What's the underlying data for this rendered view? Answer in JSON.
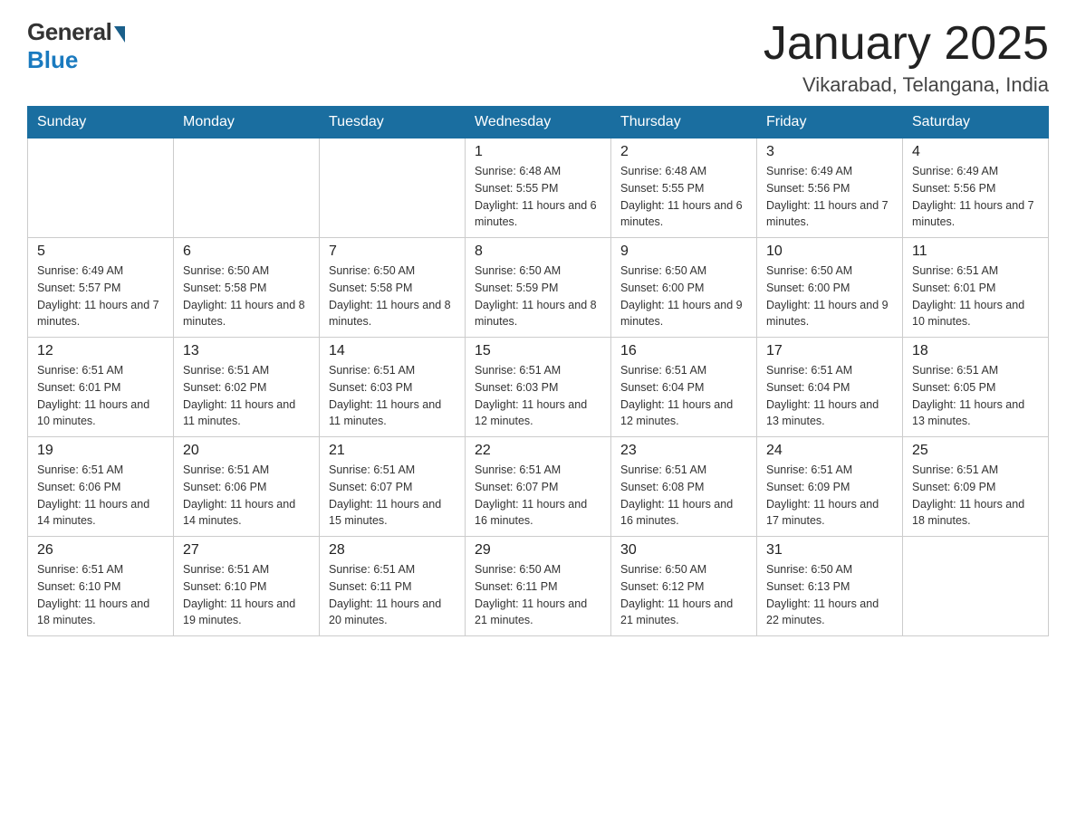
{
  "header": {
    "logo_general": "General",
    "logo_blue": "Blue",
    "title": "January 2025",
    "subtitle": "Vikarabad, Telangana, India"
  },
  "days_of_week": [
    "Sunday",
    "Monday",
    "Tuesday",
    "Wednesday",
    "Thursday",
    "Friday",
    "Saturday"
  ],
  "weeks": [
    [
      {
        "day": "",
        "info": ""
      },
      {
        "day": "",
        "info": ""
      },
      {
        "day": "",
        "info": ""
      },
      {
        "day": "1",
        "info": "Sunrise: 6:48 AM\nSunset: 5:55 PM\nDaylight: 11 hours and 6 minutes."
      },
      {
        "day": "2",
        "info": "Sunrise: 6:48 AM\nSunset: 5:55 PM\nDaylight: 11 hours and 6 minutes."
      },
      {
        "day": "3",
        "info": "Sunrise: 6:49 AM\nSunset: 5:56 PM\nDaylight: 11 hours and 7 minutes."
      },
      {
        "day": "4",
        "info": "Sunrise: 6:49 AM\nSunset: 5:56 PM\nDaylight: 11 hours and 7 minutes."
      }
    ],
    [
      {
        "day": "5",
        "info": "Sunrise: 6:49 AM\nSunset: 5:57 PM\nDaylight: 11 hours and 7 minutes."
      },
      {
        "day": "6",
        "info": "Sunrise: 6:50 AM\nSunset: 5:58 PM\nDaylight: 11 hours and 8 minutes."
      },
      {
        "day": "7",
        "info": "Sunrise: 6:50 AM\nSunset: 5:58 PM\nDaylight: 11 hours and 8 minutes."
      },
      {
        "day": "8",
        "info": "Sunrise: 6:50 AM\nSunset: 5:59 PM\nDaylight: 11 hours and 8 minutes."
      },
      {
        "day": "9",
        "info": "Sunrise: 6:50 AM\nSunset: 6:00 PM\nDaylight: 11 hours and 9 minutes."
      },
      {
        "day": "10",
        "info": "Sunrise: 6:50 AM\nSunset: 6:00 PM\nDaylight: 11 hours and 9 minutes."
      },
      {
        "day": "11",
        "info": "Sunrise: 6:51 AM\nSunset: 6:01 PM\nDaylight: 11 hours and 10 minutes."
      }
    ],
    [
      {
        "day": "12",
        "info": "Sunrise: 6:51 AM\nSunset: 6:01 PM\nDaylight: 11 hours and 10 minutes."
      },
      {
        "day": "13",
        "info": "Sunrise: 6:51 AM\nSunset: 6:02 PM\nDaylight: 11 hours and 11 minutes."
      },
      {
        "day": "14",
        "info": "Sunrise: 6:51 AM\nSunset: 6:03 PM\nDaylight: 11 hours and 11 minutes."
      },
      {
        "day": "15",
        "info": "Sunrise: 6:51 AM\nSunset: 6:03 PM\nDaylight: 11 hours and 12 minutes."
      },
      {
        "day": "16",
        "info": "Sunrise: 6:51 AM\nSunset: 6:04 PM\nDaylight: 11 hours and 12 minutes."
      },
      {
        "day": "17",
        "info": "Sunrise: 6:51 AM\nSunset: 6:04 PM\nDaylight: 11 hours and 13 minutes."
      },
      {
        "day": "18",
        "info": "Sunrise: 6:51 AM\nSunset: 6:05 PM\nDaylight: 11 hours and 13 minutes."
      }
    ],
    [
      {
        "day": "19",
        "info": "Sunrise: 6:51 AM\nSunset: 6:06 PM\nDaylight: 11 hours and 14 minutes."
      },
      {
        "day": "20",
        "info": "Sunrise: 6:51 AM\nSunset: 6:06 PM\nDaylight: 11 hours and 14 minutes."
      },
      {
        "day": "21",
        "info": "Sunrise: 6:51 AM\nSunset: 6:07 PM\nDaylight: 11 hours and 15 minutes."
      },
      {
        "day": "22",
        "info": "Sunrise: 6:51 AM\nSunset: 6:07 PM\nDaylight: 11 hours and 16 minutes."
      },
      {
        "day": "23",
        "info": "Sunrise: 6:51 AM\nSunset: 6:08 PM\nDaylight: 11 hours and 16 minutes."
      },
      {
        "day": "24",
        "info": "Sunrise: 6:51 AM\nSunset: 6:09 PM\nDaylight: 11 hours and 17 minutes."
      },
      {
        "day": "25",
        "info": "Sunrise: 6:51 AM\nSunset: 6:09 PM\nDaylight: 11 hours and 18 minutes."
      }
    ],
    [
      {
        "day": "26",
        "info": "Sunrise: 6:51 AM\nSunset: 6:10 PM\nDaylight: 11 hours and 18 minutes."
      },
      {
        "day": "27",
        "info": "Sunrise: 6:51 AM\nSunset: 6:10 PM\nDaylight: 11 hours and 19 minutes."
      },
      {
        "day": "28",
        "info": "Sunrise: 6:51 AM\nSunset: 6:11 PM\nDaylight: 11 hours and 20 minutes."
      },
      {
        "day": "29",
        "info": "Sunrise: 6:50 AM\nSunset: 6:11 PM\nDaylight: 11 hours and 21 minutes."
      },
      {
        "day": "30",
        "info": "Sunrise: 6:50 AM\nSunset: 6:12 PM\nDaylight: 11 hours and 21 minutes."
      },
      {
        "day": "31",
        "info": "Sunrise: 6:50 AM\nSunset: 6:13 PM\nDaylight: 11 hours and 22 minutes."
      },
      {
        "day": "",
        "info": ""
      }
    ]
  ]
}
